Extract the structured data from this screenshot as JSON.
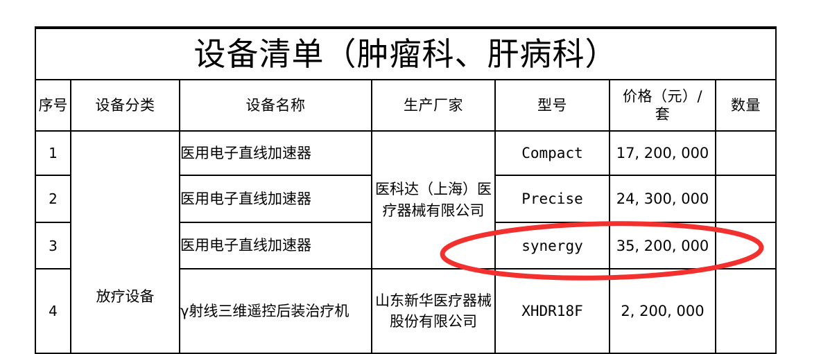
{
  "document": {
    "title": "设备清单（肿瘤科、肝病科）",
    "annotation": {
      "type": "hand-drawn-ellipse",
      "color": "#f2312f",
      "target_row_index": 3,
      "target_text": "synergy 35, 200, 000"
    }
  },
  "table": {
    "columns": [
      {
        "key": "index",
        "label": "序号"
      },
      {
        "key": "category",
        "label": "设备分类"
      },
      {
        "key": "name",
        "label": "设备名称"
      },
      {
        "key": "manufacturer",
        "label": "生产厂家"
      },
      {
        "key": "model",
        "label": "型号"
      },
      {
        "key": "price",
        "label": "价格（元）/套"
      },
      {
        "key": "quantity",
        "label": "数量"
      }
    ],
    "header": {
      "index": "序号",
      "category": "设备分类",
      "name": "设备名称",
      "manufacturer": "生产厂家",
      "price_line1": "价格（元）/",
      "price_line2": "套",
      "model": "型号",
      "quantity": "数量"
    },
    "merged": {
      "category_all_rows": "放疗设备",
      "manufacturer_rows_1_3": "医科达（上海）医疗器械有限公司"
    },
    "rows": [
      {
        "index": "1",
        "name": "医用电子直线加速器",
        "model": "Compact",
        "price": "17, 200, 000",
        "quantity": ""
      },
      {
        "index": "2",
        "name": "医用电子直线加速器",
        "model": "Precise",
        "price": "24, 300, 000",
        "quantity": ""
      },
      {
        "index": "3",
        "name": "医用电子直线加速器",
        "model": "synergy",
        "price": "35, 200, 000",
        "quantity": ""
      },
      {
        "index": "4",
        "name": "γ射线三维遥控后装治疗机",
        "manufacturer": "山东新华医疗器械股份有限公司",
        "model": "XHDR18F",
        "price": "2, 200, 000",
        "quantity": ""
      }
    ]
  }
}
